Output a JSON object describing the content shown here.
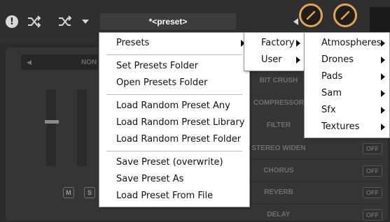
{
  "toolbar": {
    "alert_icon": "!",
    "preset_name": "*<preset>",
    "icons": [
      "alert-icon",
      "shuffle-icon",
      "shuffle-alt-icon",
      "chevron-down-icon",
      "chevron-left-icon",
      "chevron-right-icon"
    ],
    "knob_color": "#e2a64a"
  },
  "body": {
    "mode_text": "NON",
    "mute_label": "M",
    "solo_label": "S",
    "effects": [
      {
        "name": "BIT CRUSH",
        "state": ""
      },
      {
        "name": "COMPRESSOR",
        "state": ""
      },
      {
        "name": "FILTER",
        "state": ""
      },
      {
        "name": "STEREO WIDEN",
        "state": "OFF"
      },
      {
        "name": "CHORUS",
        "state": "OFF"
      },
      {
        "name": "REVERB",
        "state": "OFF"
      },
      {
        "name": "DELAY",
        "state": "OFF"
      }
    ]
  },
  "menu": {
    "items": [
      {
        "label": "Presets",
        "submenu": true
      },
      {
        "label": "Set Presets Folder"
      },
      {
        "label": "Open Presets Folder"
      },
      {
        "label": "Load Random Preset Any"
      },
      {
        "label": "Load Random Preset Library"
      },
      {
        "label": "Load Random Preset Folder"
      },
      {
        "label": "Save Preset (overwrite)"
      },
      {
        "label": "Save Preset As"
      },
      {
        "label": "Load Preset From File"
      }
    ]
  },
  "presets_submenu": {
    "items": [
      {
        "label": "Factory",
        "submenu": true
      },
      {
        "label": "User",
        "submenu": true
      }
    ]
  },
  "factory_submenu": {
    "items": [
      {
        "label": "Atmospheres",
        "submenu": true
      },
      {
        "label": "Drones",
        "submenu": true
      },
      {
        "label": "Pads",
        "submenu": true
      },
      {
        "label": "Sam",
        "submenu": true
      },
      {
        "label": "Sfx",
        "submenu": true
      },
      {
        "label": "Textures",
        "submenu": true
      }
    ]
  }
}
